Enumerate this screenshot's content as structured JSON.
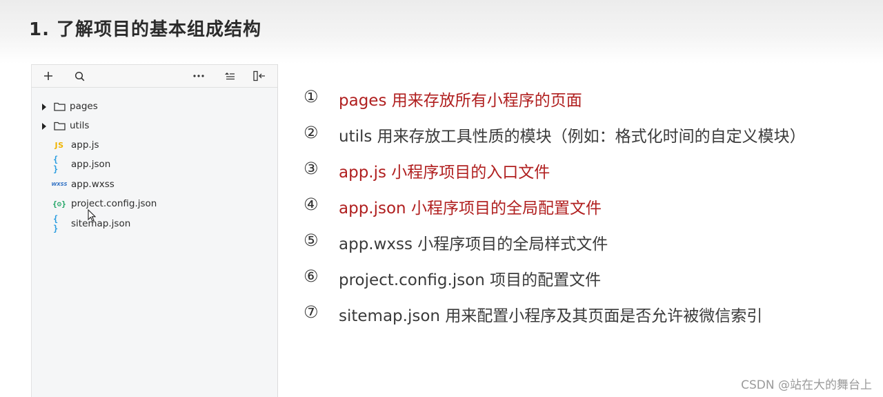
{
  "slide": {
    "title": "1. 了解项目的基本组成结构"
  },
  "explorer": {
    "toolbar": [
      {
        "name": "add-icon"
      },
      {
        "name": "search-icon"
      },
      {
        "name": "more-icon"
      },
      {
        "name": "collapse-list-icon"
      },
      {
        "name": "toggle-panel-icon"
      }
    ],
    "tree": [
      {
        "type": "folder",
        "label": "pages",
        "icon": "folder-icon"
      },
      {
        "type": "folder",
        "label": "utils",
        "icon": "folder-icon"
      },
      {
        "type": "file",
        "label": "app.js",
        "icon": "js-file-icon",
        "icon_text": "JS"
      },
      {
        "type": "file",
        "label": "app.json",
        "icon": "json-file-icon",
        "icon_text": "{ }"
      },
      {
        "type": "file",
        "label": "app.wxss",
        "icon": "wxss-file-icon",
        "icon_text": "WXSS"
      },
      {
        "type": "file",
        "label": "project.config.json",
        "icon": "config-file-icon",
        "icon_text": "{⚙}"
      },
      {
        "type": "file",
        "label": "sitemap.json",
        "icon": "json-file-icon",
        "icon_text": "{ }"
      }
    ]
  },
  "descriptions": [
    {
      "num": "①",
      "text": "pages 用来存放所有小程序的页面",
      "color": "#b01f1f"
    },
    {
      "num": "②",
      "text": "utils 用来存放工具性质的模块（例如：格式化时间的自定义模块）",
      "color": "#3a3a3a"
    },
    {
      "num": "③",
      "text": "app.js 小程序项目的入口文件",
      "color": "#b01f1f"
    },
    {
      "num": "④",
      "text": "app.json 小程序项目的全局配置文件",
      "color": "#b01f1f"
    },
    {
      "num": "⑤",
      "text": "app.wxss 小程序项目的全局样式文件",
      "color": "#3a3a3a"
    },
    {
      "num": "⑥",
      "text": "project.config.json 项目的配置文件",
      "color": "#3a3a3a"
    },
    {
      "num": "⑦",
      "text": "sitemap.json 用来配置小程序及其页面是否允许被微信索引",
      "color": "#3a3a3a"
    }
  ],
  "watermark": "CSDN @站在大的舞台上"
}
